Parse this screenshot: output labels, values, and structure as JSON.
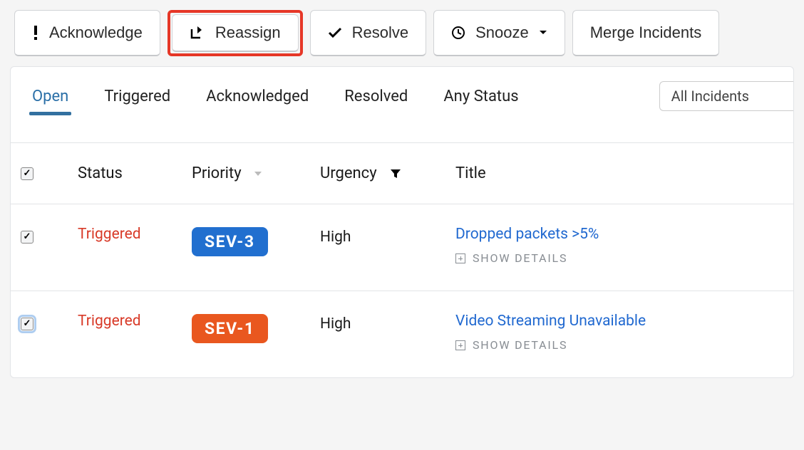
{
  "toolbar": {
    "acknowledge": "Acknowledge",
    "reassign": "Reassign",
    "resolve": "Resolve",
    "snooze": "Snooze",
    "merge": "Merge Incidents"
  },
  "tabs": {
    "open": "Open",
    "triggered": "Triggered",
    "acknowledged": "Acknowledged",
    "resolved": "Resolved",
    "any": "Any Status"
  },
  "filter": {
    "label": "All Incidents"
  },
  "columns": {
    "status": "Status",
    "priority": "Priority",
    "urgency": "Urgency",
    "title": "Title"
  },
  "details_label": "SHOW DETAILS",
  "rows": [
    {
      "status": "Triggered",
      "priority": "SEV-3",
      "priority_color": "sev-blue",
      "urgency": "High",
      "title": "Dropped packets >5%",
      "checked": true,
      "focused": false
    },
    {
      "status": "Triggered",
      "priority": "SEV-1",
      "priority_color": "sev-orange",
      "urgency": "High",
      "title": "Video Streaming Unavailable",
      "checked": true,
      "focused": true
    }
  ]
}
